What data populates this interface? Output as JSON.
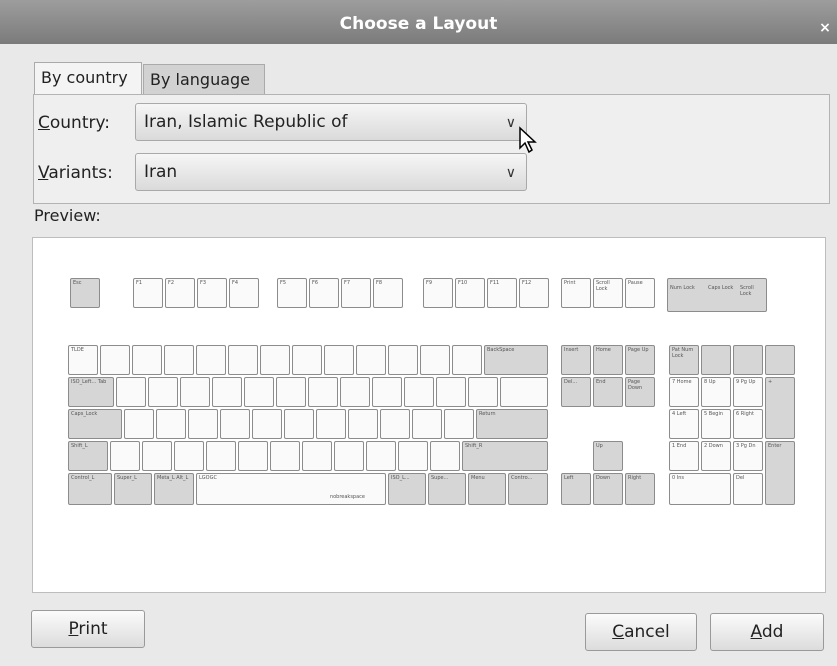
{
  "window": {
    "title": "Choose a Layout",
    "close_glyph": "×"
  },
  "tabs": [
    {
      "label": "By country",
      "selected": true
    },
    {
      "label": "By language",
      "selected": false
    }
  ],
  "country": {
    "label_mnemonic": "C",
    "label_rest": "ountry:",
    "value": "Iran, Islamic Republic of"
  },
  "variants": {
    "label_mnemonic": "V",
    "label_rest": "ariants:",
    "value": "Iran"
  },
  "preview": {
    "label": "Preview:"
  },
  "keyboard": {
    "function_row": [
      "Esc",
      "F1",
      "F2",
      "F3",
      "F4",
      "F5",
      "F6",
      "F7",
      "F8",
      "F9",
      "F10",
      "F11",
      "F12"
    ],
    "system_keys": [
      "Print",
      "Scroll Lock",
      "Pause"
    ],
    "indicators": [
      "Num Lock",
      "Caps Lock",
      "Scroll Lock"
    ],
    "named_keys": {
      "tlde": "TLDE",
      "backspace": "BackSpace",
      "tab": "ISO_Left... Tab",
      "caps": "Caps_Lock",
      "return": "Return",
      "shift_l": "Shift_L",
      "shift_r": "Shift_R",
      "ctrl_l": "Control_L",
      "super_l": "Super_L",
      "alt_l": "Meta_L Alt_L",
      "space": "LGOGC",
      "space_sub": "nobreakspace",
      "iso_level": "ISO_L...",
      "super_r": "Supe...",
      "menu": "Menu",
      "ctrl_r": "Contro...",
      "insert": "Insert",
      "home": "Home",
      "pgup": "Page Up",
      "delete": "Del...",
      "end": "End",
      "pgdn": "Page Down",
      "up": "Up",
      "left": "Left",
      "down": "Down",
      "right": "Right",
      "numlock": "Pat Num Lock",
      "kp7": "7 Home",
      "kp8": "8 Up",
      "kp9": "9 Pg Up",
      "kp4": "4 Left",
      "kp5": "5 Begin",
      "kp6": "6 Right",
      "kp1": "1 End",
      "kp2": "2 Down",
      "kp3": "3 Pg Dn",
      "kp0": "0 Ins",
      "kpdel": "Del",
      "kpenter": "Enter",
      "kpplus": "+"
    }
  },
  "buttons": {
    "print": {
      "mnemonic": "P",
      "rest": "rint"
    },
    "cancel": {
      "mnemonic": "C",
      "rest": "ancel"
    },
    "add": {
      "mnemonic": "A",
      "rest": "dd"
    }
  }
}
